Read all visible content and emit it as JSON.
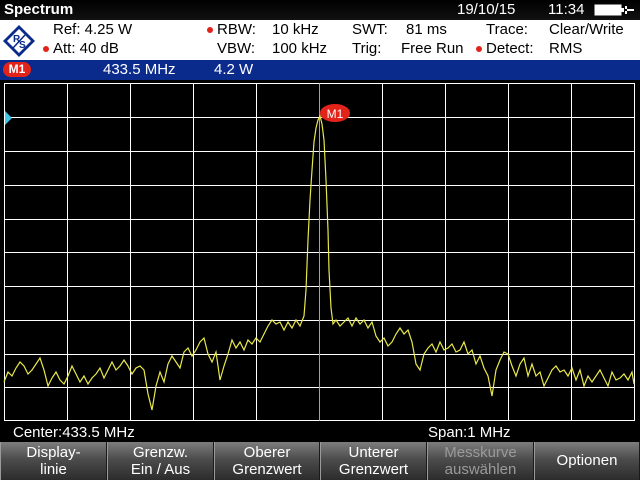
{
  "header": {
    "title": "Spectrum",
    "date": "19/10/15",
    "time": "11:34"
  },
  "params": {
    "ref": "Ref:  4.25 W",
    "att": "Att:  40 dB",
    "rbw_label": "RBW:",
    "rbw_value": "10 kHz",
    "vbw_label": "VBW:",
    "vbw_value": "100 kHz",
    "swt_label": "SWT:",
    "swt_value": "81 ms",
    "trig_label": "Trig:",
    "trig_value": "Free Run",
    "trace_label": "Trace:",
    "trace_value": "Clear/Write",
    "detect_label": "Detect:",
    "detect_value": "RMS"
  },
  "marker": {
    "badge": "M1",
    "frequency": "433.5  MHz",
    "level": "4.2  W",
    "plot_label": "M1"
  },
  "footer": {
    "center": "Center:433.5 MHz",
    "span": "Span:1 MHz"
  },
  "softkeys": [
    {
      "line1": "Display-",
      "line2": "linie",
      "enabled": true
    },
    {
      "line1": "Grenzw.",
      "line2": "Ein / Aus",
      "enabled": true
    },
    {
      "line1": "Oberer",
      "line2": "Grenzwert",
      "enabled": true
    },
    {
      "line1": "Unterer",
      "line2": "Grenzwert",
      "enabled": true
    },
    {
      "line1": "Messkurve",
      "line2": "auswählen",
      "enabled": false
    },
    {
      "line1": "Optionen",
      "line2": "",
      "enabled": true
    }
  ],
  "colors": {
    "trace": "#e8e84a",
    "marker_line": "#3fc6e6",
    "marker_badge": "#e2231a",
    "marker_bar": "#0a2a8c"
  }
}
